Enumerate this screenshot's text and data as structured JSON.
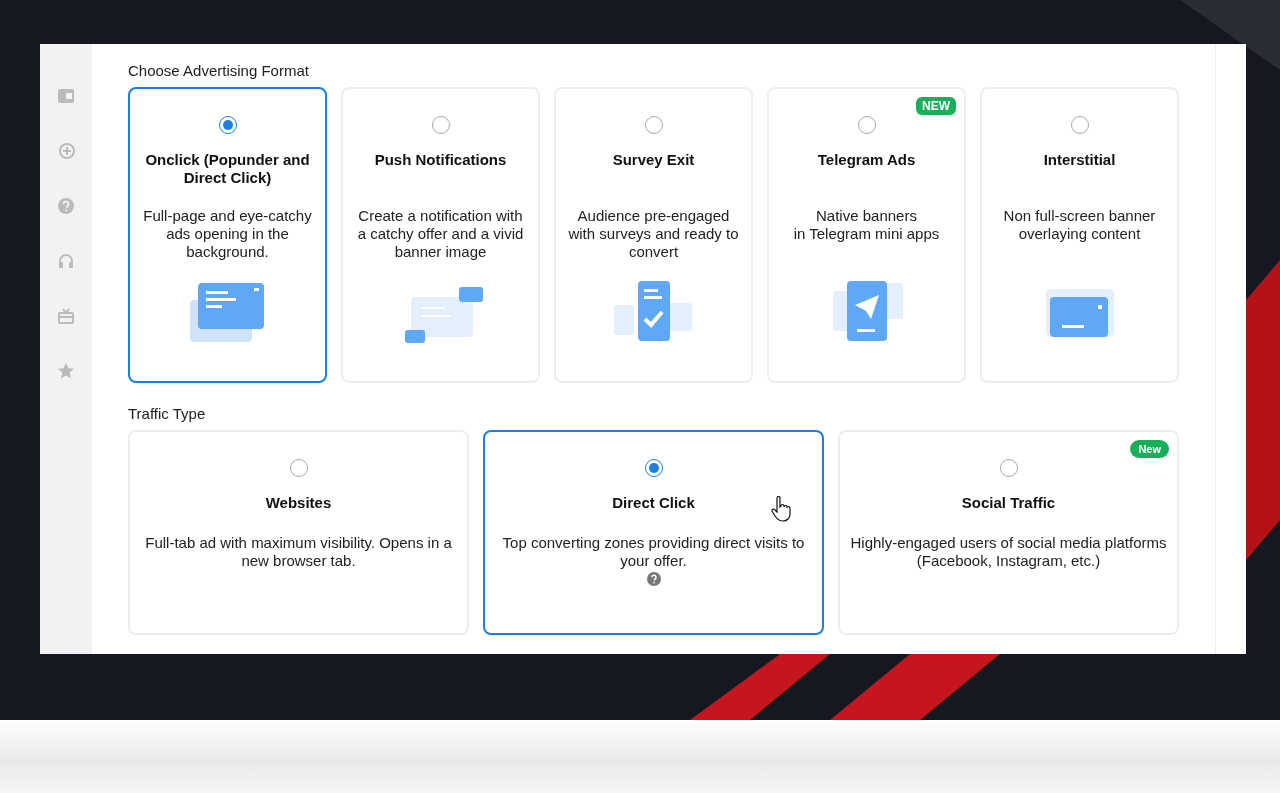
{
  "format_section": {
    "title": "Choose Advertising Format",
    "options": [
      {
        "kind": "onclick",
        "title": "Onclick (Popunder and Direct Click)",
        "description": "Full-page and eye-catchy ads opening in the background.",
        "selected": true
      },
      {
        "kind": "push",
        "title": "Push Notifications",
        "description": "Create a notification with a catchy offer and a vivid banner image",
        "selected": false
      },
      {
        "kind": "survey",
        "title": "Survey Exit",
        "description": "Audience pre-engaged with surveys and ready to convert",
        "selected": false
      },
      {
        "kind": "telegram",
        "title": "Telegram Ads",
        "description": "Native banners\nin Telegram mini apps",
        "selected": false,
        "badge": "NEW"
      },
      {
        "kind": "interstitial",
        "title": "Interstitial",
        "description": "Non full-screen banner overlaying content",
        "selected": false
      }
    ]
  },
  "traffic_section": {
    "title": "Traffic Type",
    "options": [
      {
        "title": "Websites",
        "description": "Full-tab ad with maximum visibility. Opens in a new browser tab.",
        "selected": false,
        "help": false
      },
      {
        "title": "Direct Click",
        "description": "Top converting zones providing direct visits to your offer.",
        "selected": true,
        "help": true
      },
      {
        "title": "Social Traffic",
        "description": "Highly-engaged users of social media platforms (Facebook, Instagram, etc.)",
        "selected": false,
        "help": false,
        "badge": "New"
      }
    ]
  }
}
